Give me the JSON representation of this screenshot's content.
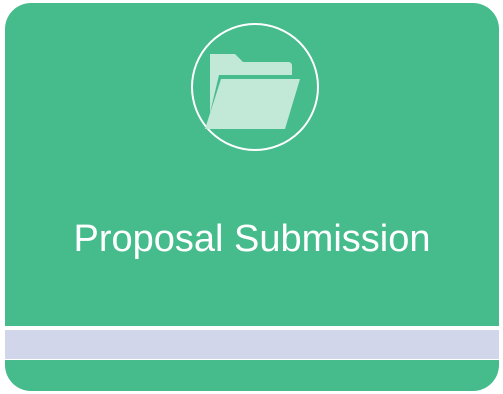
{
  "card": {
    "title": "Proposal Submission",
    "icon": "folder-open-icon"
  },
  "colors": {
    "card_green": "#46BC8C",
    "strip_lavender": "#D1D6EA",
    "icon_fill": "#C2E8D8",
    "border_white": "#FFFFFF"
  }
}
